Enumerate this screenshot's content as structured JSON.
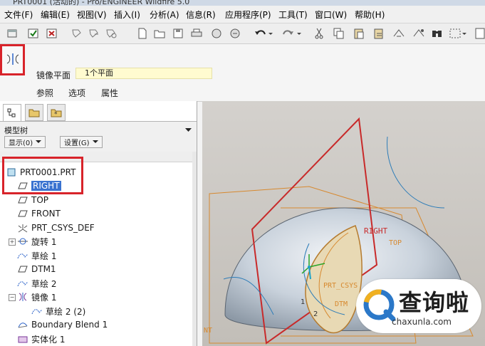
{
  "window": {
    "title": "PRT0001 (活动的) - Pro/ENGINEER Wildfire 5.0"
  },
  "menu": [
    "文件(F)",
    "编辑(E)",
    "视图(V)",
    "插入(I)",
    "分析(A)",
    "信息(R)",
    "应用程序(P)",
    "工具(T)",
    "窗口(W)",
    "帮助(H)"
  ],
  "dashboard": {
    "mirror_plane_label": "镜像平面",
    "mirror_plane_value": "1个平面",
    "tabs": [
      "参照",
      "选项",
      "属性"
    ]
  },
  "model_tree": {
    "label": "模型树",
    "show_button": "显示(0)",
    "settings_button": "设置(G)",
    "items": [
      {
        "label": "PRT0001.PRT",
        "icon": "part-icon",
        "selected": false
      },
      {
        "label": "RIGHT",
        "icon": "datum-plane-icon",
        "selected": true
      },
      {
        "label": "TOP",
        "icon": "datum-plane-icon",
        "selected": false
      },
      {
        "label": "FRONT",
        "icon": "datum-plane-icon",
        "selected": false
      },
      {
        "label": "PRT_CSYS_DEF",
        "icon": "coordinate-system-icon",
        "selected": false
      },
      {
        "label": "旋转 1",
        "icon": "revolve-icon",
        "selected": false
      },
      {
        "label": "草绘 1",
        "icon": "sketch-icon",
        "selected": false
      },
      {
        "label": "DTM1",
        "icon": "datum-plane-icon",
        "selected": false
      },
      {
        "label": "草绘 2",
        "icon": "sketch-icon",
        "selected": false
      },
      {
        "label": "镜像 1",
        "icon": "mirror-icon",
        "selected": false
      },
      {
        "label": "草绘 2 (2)",
        "icon": "sketch-icon",
        "selected": false
      },
      {
        "label": "Boundary Blend 1",
        "icon": "boundary-blend-icon",
        "selected": false
      },
      {
        "label": "实体化 1",
        "icon": "solidify-icon",
        "selected": false
      }
    ]
  },
  "viewport": {
    "labels": {
      "right": "RIGHT",
      "top": "TOP",
      "csys": "PRT_CSYS",
      "dtm": "DTM",
      "front": "NT",
      "num1": "1",
      "num2": "2"
    }
  },
  "watermark": {
    "brand": "查询啦",
    "url": "chaxunla.com"
  },
  "colors": {
    "highlight": "#3a73d0",
    "annotation_red": "#d8232a",
    "datum_orange": "#d7892f",
    "plane_red": "#c82a2a"
  }
}
